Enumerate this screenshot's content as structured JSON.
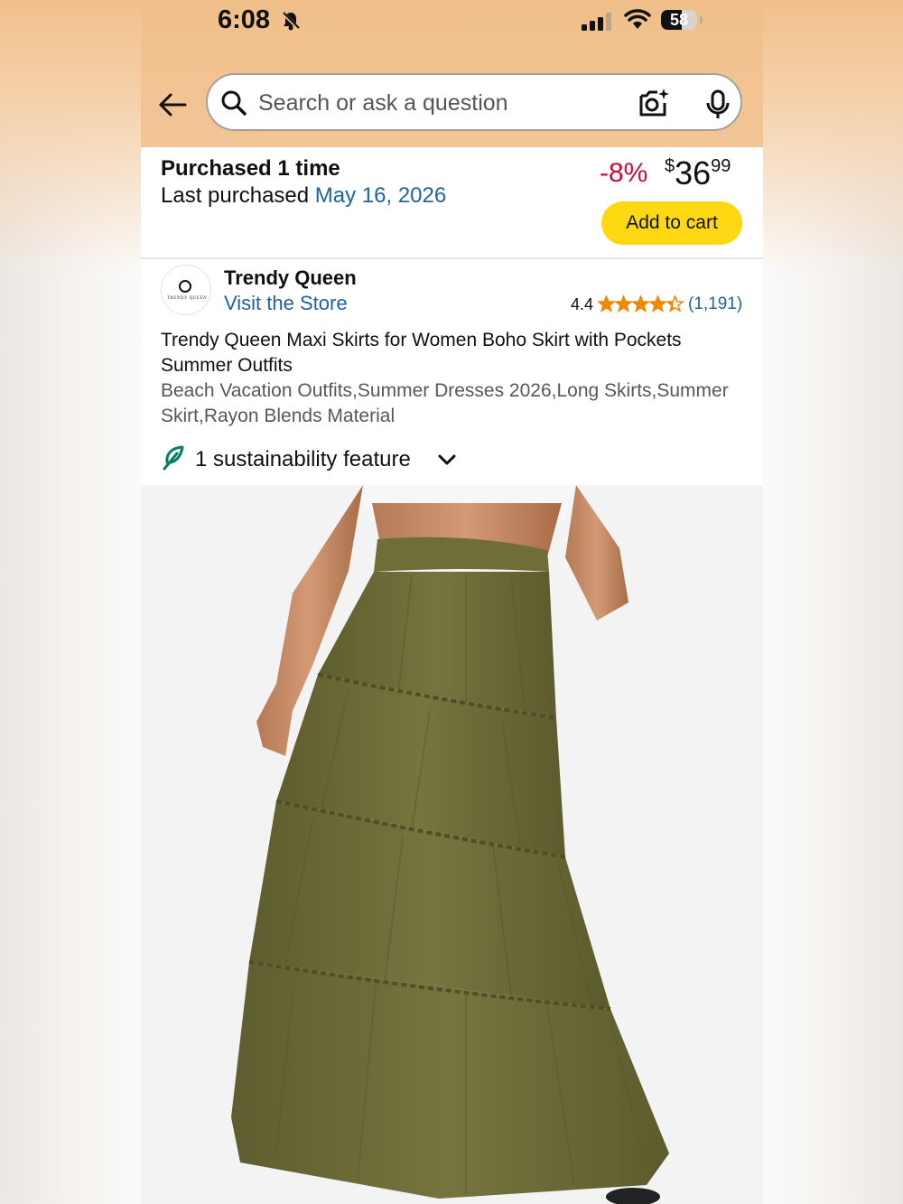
{
  "status_bar": {
    "time": "6:08",
    "battery": "58",
    "battery_level": 0.58
  },
  "search": {
    "placeholder": "Search or ask a question"
  },
  "purchase": {
    "title": "Purchased 1 time",
    "last_label": "Last purchased",
    "last_date": "May 16, 2026",
    "discount": "-8%",
    "price_symbol": "$",
    "price_whole": "36",
    "price_fraction": "99",
    "add_to_cart": "Add to cart"
  },
  "store": {
    "name": "Trendy Queen",
    "visit": "Visit the Store",
    "logo_text": "TRENDY QUEEN",
    "rating": "4.4",
    "rating_value": 4.4,
    "rating_count": "(1,191)"
  },
  "product": {
    "title": "Trendy Queen Maxi Skirts for Women Boho Skirt with Pockets Summer Outfits",
    "subtitle": "Beach Vacation Outfits,Summer Dresses 2026,Long Skirts,Summer Skirt,Rayon Blends Material",
    "sustainability": "1 sustainability feature"
  },
  "colors": {
    "header": "#f2c493",
    "price_discount": "#cc0c39",
    "link": "#2162a1",
    "cart_button": "#ffd814",
    "star": "#f08804",
    "skirt": "#6f6e3a"
  },
  "icons": [
    "back-arrow-icon",
    "search-icon",
    "camera-icon",
    "mic-icon",
    "bell-off-icon",
    "signal-icon",
    "wifi-icon",
    "leaf-icon",
    "chevron-down-icon",
    "star-icon"
  ]
}
